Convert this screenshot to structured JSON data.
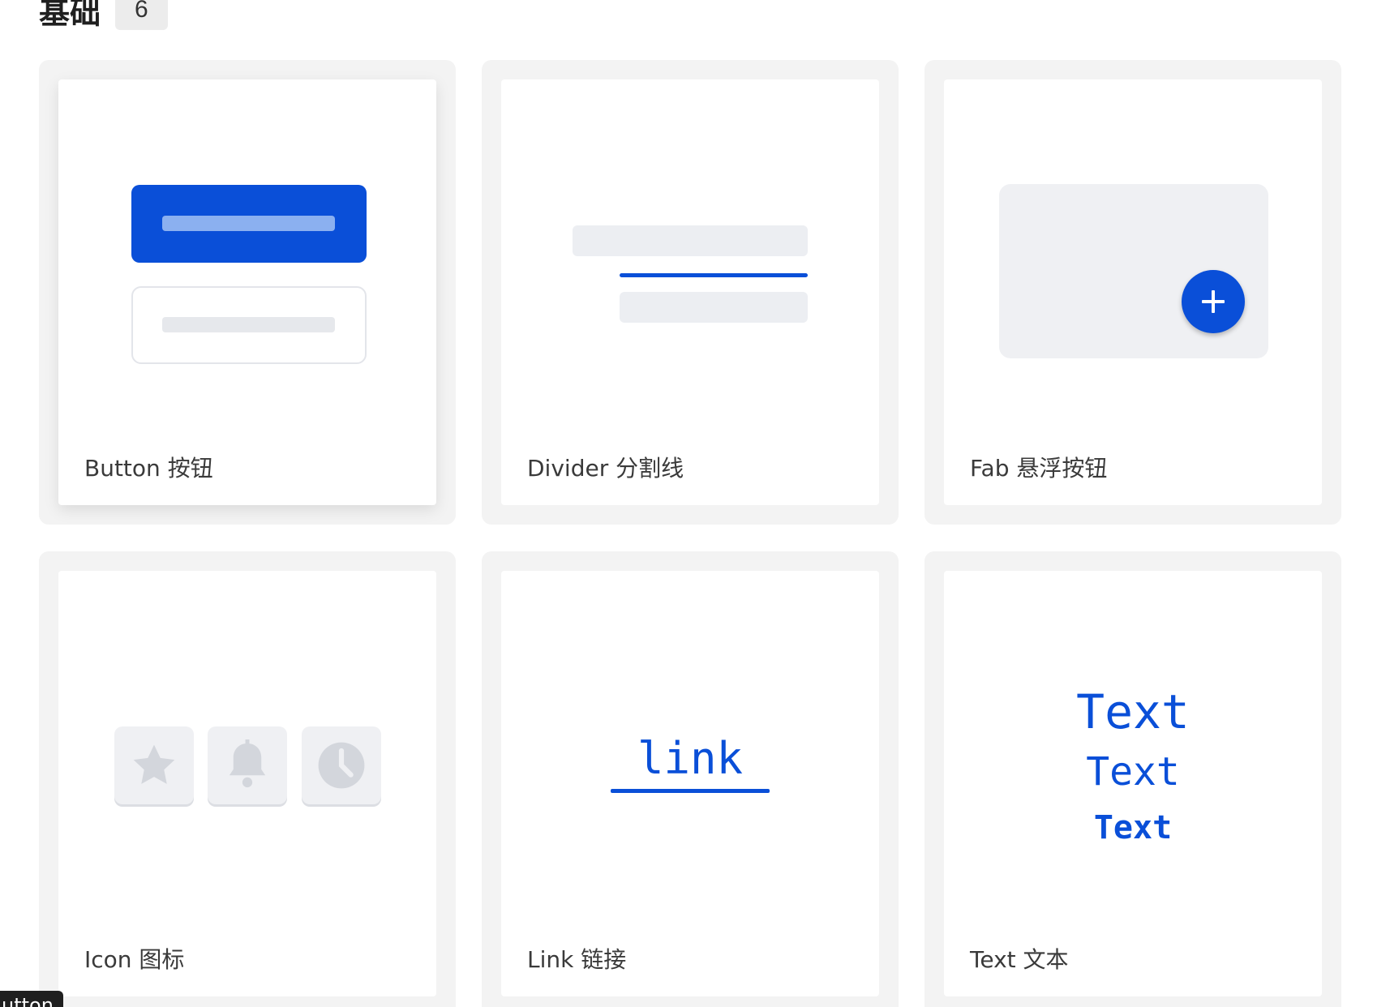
{
  "section": {
    "title": "基础",
    "count": "6"
  },
  "cards": {
    "button": {
      "label": "Button 按钮"
    },
    "divider": {
      "label": "Divider 分割线"
    },
    "fab": {
      "label": "Fab 悬浮按钮",
      "fab_glyph": "+"
    },
    "icon": {
      "label": "Icon 图标",
      "icons": [
        "star-icon",
        "bell-icon",
        "clock-icon"
      ]
    },
    "link": {
      "label": "Link 链接",
      "preview_text": "link"
    },
    "text": {
      "label": "Text 文本",
      "preview_lines": [
        "Text",
        "Text",
        "Text"
      ]
    }
  },
  "tooltip": {
    "text": "utton"
  },
  "colors": {
    "accent": "#0a4fd8",
    "placeholder": "#eceef2",
    "card_bg": "#f3f3f3"
  }
}
